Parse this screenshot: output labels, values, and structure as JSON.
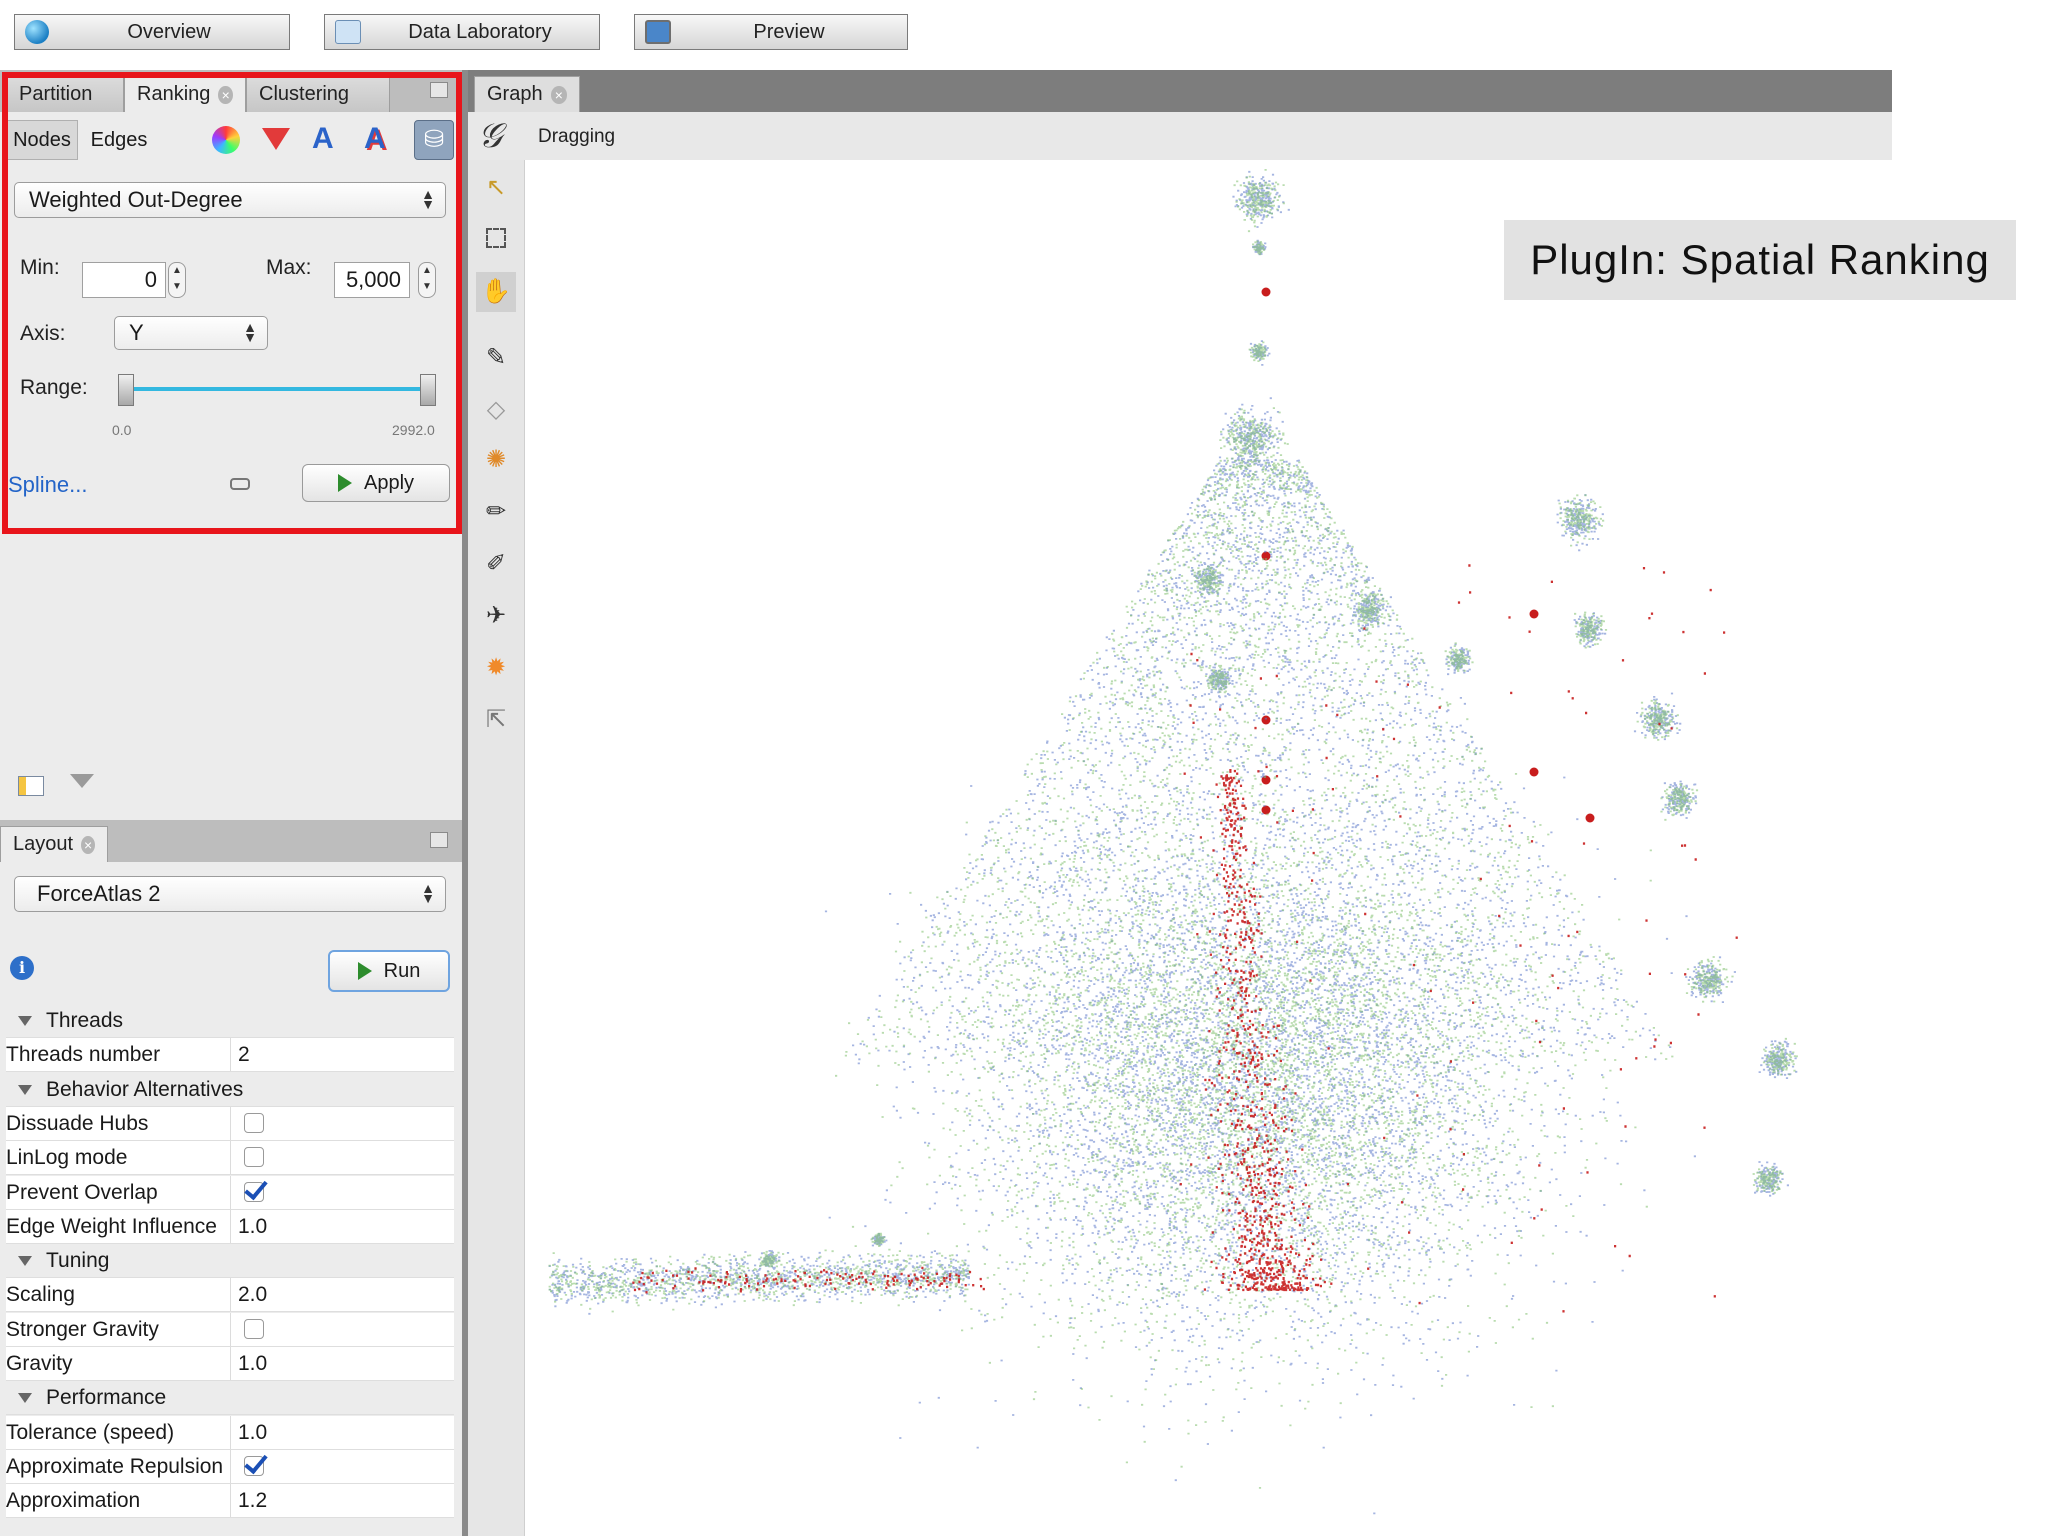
{
  "modes": [
    {
      "label": "Overview",
      "icon": "globe-icon"
    },
    {
      "label": "Data Laboratory",
      "icon": "table-icon"
    },
    {
      "label": "Preview",
      "icon": "monitor-icon"
    }
  ],
  "ranking_panel": {
    "tabs": [
      "Partition",
      "Ranking",
      "Clustering"
    ],
    "active_tab": "Ranking",
    "subtabs": [
      "Nodes",
      "Edges"
    ],
    "attribute": "Weighted Out-Degree",
    "min_label": "Min:",
    "min_value": "0",
    "max_label": "Max:",
    "max_value": "5,000",
    "axis_label": "Axis:",
    "axis_value": "Y",
    "range_label": "Range:",
    "range_min": "0.0",
    "range_max": "2992.0",
    "spline_link": "Spline...",
    "apply_label": "Apply",
    "highlight_color": "#e8151b"
  },
  "layout_panel": {
    "tab": "Layout",
    "algorithm": "ForceAtlas 2",
    "run_label": "Run",
    "properties": [
      {
        "type": "category",
        "label": "Threads"
      },
      {
        "type": "value",
        "label": "Threads number",
        "value": "2"
      },
      {
        "type": "category",
        "label": "Behavior Alternatives"
      },
      {
        "type": "check",
        "label": "Dissuade Hubs",
        "checked": false
      },
      {
        "type": "check",
        "label": "LinLog mode",
        "checked": false
      },
      {
        "type": "check",
        "label": "Prevent Overlap",
        "checked": true
      },
      {
        "type": "value",
        "label": "Edge Weight Influence",
        "value": "1.0"
      },
      {
        "type": "category",
        "label": "Tuning"
      },
      {
        "type": "value",
        "label": "Scaling",
        "value": "2.0"
      },
      {
        "type": "check",
        "label": "Stronger Gravity",
        "checked": false
      },
      {
        "type": "value",
        "label": "Gravity",
        "value": "1.0"
      },
      {
        "type": "category",
        "label": "Performance"
      },
      {
        "type": "value",
        "label": "Tolerance (speed)",
        "value": "1.0"
      },
      {
        "type": "check",
        "label": "Approximate Repulsion",
        "checked": true
      },
      {
        "type": "value",
        "label": "Approximation",
        "value": "1.2"
      }
    ]
  },
  "graph": {
    "tab": "Graph",
    "mode_text": "Dragging",
    "node_colors": [
      "#5b78c8",
      "#7fbf6e",
      "#c81d1d"
    ]
  },
  "banner": "PlugIn: Spatial Ranking"
}
